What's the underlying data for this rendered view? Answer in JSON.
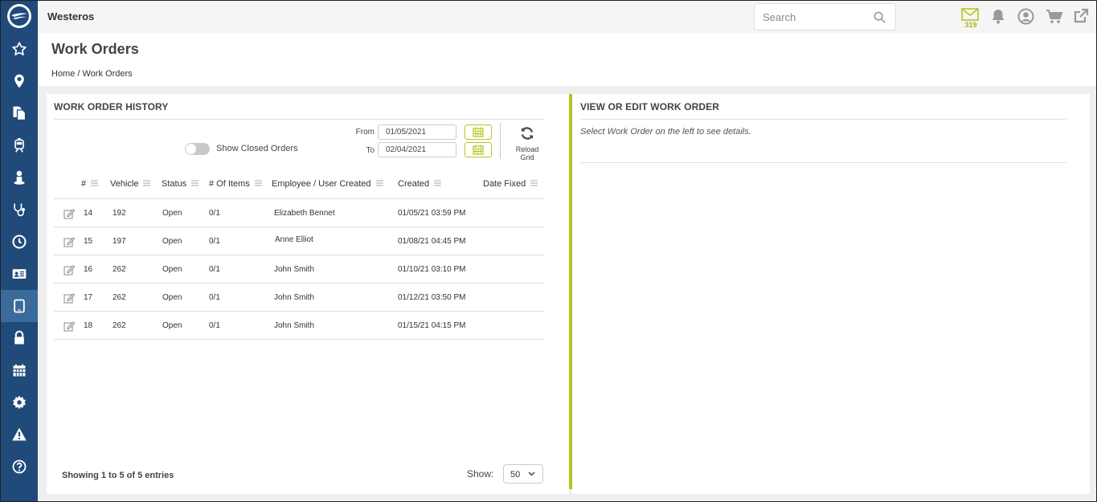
{
  "app": {
    "title": "Westeros"
  },
  "search": {
    "placeholder": "Search"
  },
  "header_icons": {
    "mail_count": "319",
    "accent": "#b7c41f"
  },
  "sidebar": {
    "items": [
      {
        "icon": "star-icon"
      },
      {
        "icon": "map-pin-icon"
      },
      {
        "icon": "documents-icon"
      },
      {
        "icon": "train-icon"
      },
      {
        "icon": "person-icon"
      },
      {
        "icon": "stethoscope-icon"
      },
      {
        "icon": "clock-icon"
      },
      {
        "icon": "id-card-icon"
      },
      {
        "icon": "tablet-icon",
        "active": true
      },
      {
        "icon": "lock-icon"
      },
      {
        "icon": "calendar-icon"
      },
      {
        "icon": "gear-icon"
      },
      {
        "icon": "warning-icon"
      },
      {
        "icon": "help-icon"
      }
    ]
  },
  "page": {
    "title": "Work Orders",
    "breadcrumb": "Home / Work Orders"
  },
  "history": {
    "heading": "WORK ORDER HISTORY",
    "toggle_label": "Show Closed Orders",
    "from_label": "From",
    "from_value": "01/05/2021",
    "to_label": "To",
    "to_value": "02/04/2021",
    "reload_line1": "Reload",
    "reload_line2": "Grid",
    "columns": [
      "#",
      "Vehicle",
      "Status",
      "# Of Items",
      "Employee / User Created",
      "Created",
      "Date Fixed"
    ],
    "rows": [
      {
        "id": "14",
        "vehicle": "192",
        "status": "Open",
        "items": "0/1",
        "employee": "Elizabeth Bennet",
        "created": "01/05/21 03:59 PM",
        "fixed": ""
      },
      {
        "id": "15",
        "vehicle": "197",
        "status": "Open",
        "items": "0/1",
        "employee": "Anne Elliot",
        "created": "01/08/21 04:45 PM",
        "fixed": ""
      },
      {
        "id": "16",
        "vehicle": "262",
        "status": "Open",
        "items": "0/1",
        "employee": "John Smith",
        "created": "01/10/21 03:10 PM",
        "fixed": ""
      },
      {
        "id": "17",
        "vehicle": "262",
        "status": "Open",
        "items": "0/1",
        "employee": "John Smith",
        "created": "01/12/21 03:50 PM",
        "fixed": ""
      },
      {
        "id": "18",
        "vehicle": "262",
        "status": "Open",
        "items": "0/1",
        "employee": "John Smith",
        "created": "01/15/21 04:15 PM",
        "fixed": ""
      }
    ],
    "showing": "Showing 1 to 5 of 5 entries",
    "show_label": "Show:",
    "page_size": "50"
  },
  "detail": {
    "heading": "VIEW OR EDIT WORK ORDER",
    "hint": "Select Work Order on the left to see details."
  }
}
